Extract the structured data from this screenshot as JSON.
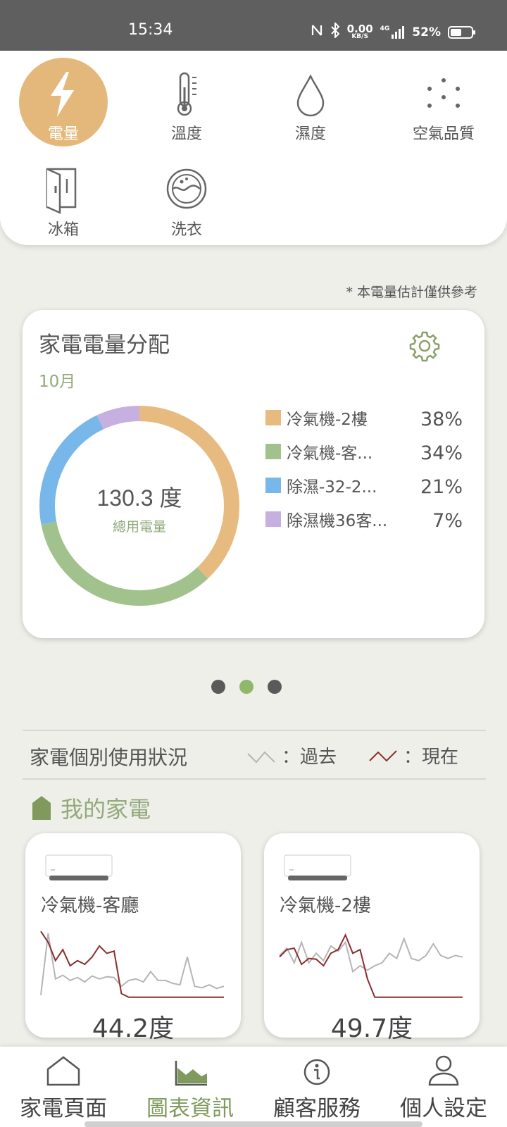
{
  "status_bar": {
    "time": "15:34",
    "net_speed_value": "0.00",
    "net_speed_unit": "KB/S",
    "network": "4G",
    "battery": "52%",
    "battery_level": 0.52
  },
  "categories": [
    {
      "label": "電量",
      "icon": "lightning-icon",
      "active": true
    },
    {
      "label": "溫度",
      "icon": "thermometer-icon"
    },
    {
      "label": "濕度",
      "icon": "water-drop-icon"
    },
    {
      "label": "空氣品質",
      "icon": "dots-icon"
    },
    {
      "label": "冰箱",
      "icon": "fridge-icon"
    },
    {
      "label": "洗衣",
      "icon": "washer-icon"
    }
  ],
  "note": "* 本電量估計僅供參考",
  "distribution": {
    "title": "家電電量分配",
    "month": "10月",
    "total_value": "130.3 度",
    "total_label": "總用電量",
    "legend": [
      {
        "name": "冷氣機-2樓",
        "pct": "38%",
        "color": "#e7bb80"
      },
      {
        "name": "冷氣機-客...",
        "pct": "34%",
        "color": "#a1c28c"
      },
      {
        "name": "除濕-32-2...",
        "pct": "21%",
        "color": "#78b7ea"
      },
      {
        "name": "除濕機36客...",
        "pct": "7%",
        "color": "#c5b0e0"
      }
    ]
  },
  "chart_data": {
    "type": "pie",
    "categories": [
      "冷氣機-2樓",
      "冷氣機-客...",
      "除濕-32-2...",
      "除濕機36客..."
    ],
    "values": [
      38,
      34,
      21,
      7
    ],
    "title": "家電電量分配"
  },
  "pager": {
    "count": 3,
    "active": 1
  },
  "usage": {
    "title": "家電個別使用狀況",
    "past_label": "：過去",
    "now_label": "：現在",
    "past_color": "#b5b5b5",
    "now_color": "#8a2e2e"
  },
  "my_home": {
    "title": "我的家電"
  },
  "devices": [
    {
      "name": "冷氣機-客廳",
      "kwh": "44.2度",
      "past": [
        8,
        92,
        30,
        35,
        28,
        32,
        26,
        34,
        30,
        33,
        32,
        20,
        28,
        30,
        26,
        40,
        28,
        28,
        24,
        22,
        60,
        20,
        18,
        22,
        17,
        20
      ],
      "now": [
        95,
        80,
        55,
        70,
        48,
        55,
        50,
        60,
        75,
        65,
        68,
        10,
        5,
        5,
        5,
        5,
        5,
        5,
        5,
        5,
        5,
        5,
        5,
        5,
        5,
        5
      ]
    },
    {
      "name": "冷氣機-2樓",
      "kwh": "49.7度",
      "past": [
        62,
        72,
        52,
        80,
        52,
        65,
        55,
        75,
        68,
        80,
        40,
        48,
        42,
        48,
        52,
        65,
        58,
        85,
        58,
        55,
        62,
        78,
        62,
        58,
        62,
        60
      ],
      "now": [
        60,
        70,
        72,
        50,
        58,
        57,
        48,
        65,
        70,
        90,
        65,
        70,
        30,
        5,
        5,
        5,
        5,
        5,
        5,
        5,
        5,
        5,
        5,
        5,
        5,
        5
      ]
    }
  ],
  "nav": [
    {
      "label": "家電頁面",
      "icon": "house-icon"
    },
    {
      "label": "圖表資訊",
      "icon": "chart-icon",
      "active": true
    },
    {
      "label": "顧客服務",
      "icon": "info-icon"
    },
    {
      "label": "個人設定",
      "icon": "person-icon"
    }
  ]
}
